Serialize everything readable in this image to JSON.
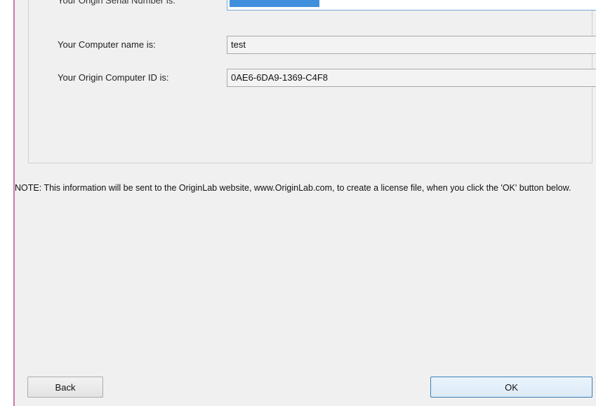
{
  "form": {
    "serial_label": "Your Origin Serial Number is:",
    "computer_name_label": "Your Computer name is:",
    "computer_name_value": "test",
    "computer_id_label": "Your Origin Computer ID is:",
    "computer_id_value": "0AE6-6DA9-1369-C4F8"
  },
  "note": "NOTE: This information will be sent to the OriginLab website, www.OriginLab.com, to create a license file, when you click the 'OK' button below.",
  "buttons": {
    "back": "Back",
    "ok": "OK"
  }
}
